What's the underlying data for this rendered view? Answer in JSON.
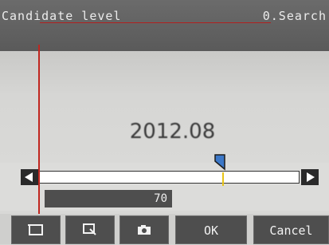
{
  "header": {
    "title": "Candidate level",
    "mode": "0.Search"
  },
  "image": {
    "text": "2012.08"
  },
  "slider": {
    "value": 70,
    "marker_fraction": 0.7,
    "thumb_fraction": 0.67
  },
  "value_box": {
    "value": "70"
  },
  "toolbar": {
    "buttons": [
      {
        "icon": "full-view-icon"
      },
      {
        "icon": "zoom-region-icon"
      },
      {
        "icon": "camera-icon"
      },
      {
        "label": "OK"
      },
      {
        "label": "Cancel"
      }
    ]
  },
  "colors": {
    "cursor_line": "#c0261f",
    "marker": "#e8c417",
    "thumb": "#3c78c8"
  }
}
